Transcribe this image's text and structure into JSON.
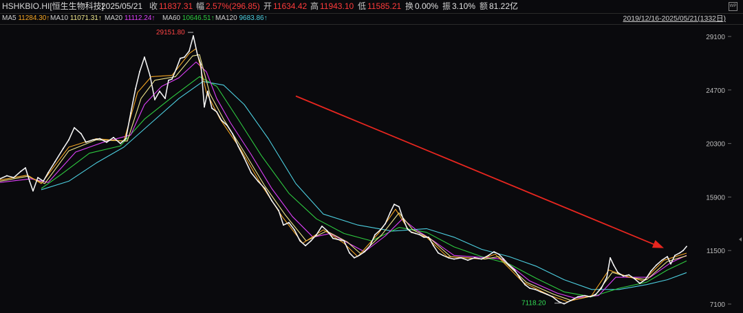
{
  "header": {
    "symbol": "HSHKBIO.HI[恒生生物科技]",
    "date": "2025/05/21",
    "close_label": "收",
    "close_value": "11837.31",
    "change_label": "幅",
    "change_value": "2.57%(296.85)",
    "open_label": "开",
    "open_value": "11634.42",
    "high_label": "高",
    "high_value": "11943.10",
    "low_label": "低",
    "low_value": "11585.21",
    "turnover_label": "换",
    "turnover_value": "0.00%",
    "amplitude_label": "振",
    "amplitude_value": "3.10%",
    "amount_label": "额",
    "amount_value": "81.22亿",
    "wp_icon": "WP"
  },
  "ma_bar": {
    "items": [
      {
        "name": "MA5",
        "value": "11284.30↑",
        "color": "#f5a623"
      },
      {
        "name": "MA10",
        "value": "11071.31↑",
        "color": "#f0e68c"
      },
      {
        "name": "MA20",
        "value": "11112.24↑",
        "color": "#e040fb"
      },
      {
        "name": "MA60",
        "value": "10646.51↑",
        "color": "#2ecc40"
      },
      {
        "name": "MA120",
        "value": "9683.86↑",
        "color": "#4dd0e1"
      }
    ],
    "range_label": "2019/12/16-2025/05/21(1332日)"
  },
  "chart_data": {
    "type": "line",
    "title": "",
    "xlabel": "",
    "ylabel": "",
    "ylim": [
      6800,
      29900
    ],
    "y_ticks": [
      "29100",
      "24700",
      "20300",
      "15900",
      "11500",
      "7100"
    ],
    "grid": false,
    "series": [
      {
        "name": "HSHKBIO.HI",
        "color": "#f2f2f2",
        "points": [
          [
            0,
            17400
          ],
          [
            10,
            17650
          ],
          [
            20,
            17500
          ],
          [
            30,
            18000
          ],
          [
            37,
            18300
          ],
          [
            43,
            17200
          ],
          [
            48,
            16400
          ],
          [
            55,
            17500
          ],
          [
            63,
            17200
          ],
          [
            70,
            17900
          ],
          [
            80,
            18800
          ],
          [
            92,
            19900
          ],
          [
            100,
            20600
          ],
          [
            108,
            21600
          ],
          [
            118,
            21100
          ],
          [
            125,
            20400
          ],
          [
            135,
            20600
          ],
          [
            145,
            20700
          ],
          [
            155,
            20400
          ],
          [
            165,
            20800
          ],
          [
            175,
            20300
          ],
          [
            183,
            20700
          ],
          [
            190,
            22800
          ],
          [
            197,
            24800
          ],
          [
            203,
            26200
          ],
          [
            210,
            27400
          ],
          [
            218,
            25900
          ],
          [
            225,
            23900
          ],
          [
            232,
            24600
          ],
          [
            240,
            24000
          ],
          [
            245,
            25500
          ],
          [
            250,
            25600
          ],
          [
            256,
            26400
          ],
          [
            262,
            27300
          ],
          [
            268,
            27400
          ],
          [
            275,
            27900
          ],
          [
            281,
            29151.8
          ],
          [
            287,
            27600
          ],
          [
            292,
            26800
          ],
          [
            297,
            23300
          ],
          [
            302,
            24600
          ],
          [
            308,
            23200
          ],
          [
            315,
            22900
          ],
          [
            322,
            22200
          ],
          [
            330,
            21800
          ],
          [
            338,
            21100
          ],
          [
            346,
            20100
          ],
          [
            355,
            19100
          ],
          [
            365,
            17900
          ],
          [
            375,
            17200
          ],
          [
            385,
            16600
          ],
          [
            395,
            15600
          ],
          [
            405,
            14800
          ],
          [
            412,
            13600
          ],
          [
            420,
            13800
          ],
          [
            428,
            13200
          ],
          [
            436,
            12300
          ],
          [
            444,
            11900
          ],
          [
            452,
            12300
          ],
          [
            460,
            12800
          ],
          [
            468,
            13500
          ],
          [
            476,
            13100
          ],
          [
            484,
            12500
          ],
          [
            492,
            12400
          ],
          [
            500,
            12300
          ],
          [
            508,
            11300
          ],
          [
            515,
            10900
          ],
          [
            522,
            11100
          ],
          [
            530,
            11400
          ],
          [
            538,
            11900
          ],
          [
            545,
            12800
          ],
          [
            553,
            13200
          ],
          [
            560,
            13700
          ],
          [
            567,
            14600
          ],
          [
            573,
            15300
          ],
          [
            580,
            15100
          ],
          [
            586,
            14100
          ],
          [
            592,
            13300
          ],
          [
            598,
            13000
          ],
          [
            604,
            12900
          ],
          [
            610,
            12800
          ],
          [
            616,
            12600
          ],
          [
            623,
            12600
          ],
          [
            630,
            11900
          ],
          [
            637,
            11300
          ],
          [
            644,
            11100
          ],
          [
            652,
            10900
          ],
          [
            660,
            10800
          ],
          [
            670,
            10900
          ],
          [
            680,
            10700
          ],
          [
            690,
            10900
          ],
          [
            700,
            10800
          ],
          [
            710,
            11100
          ],
          [
            718,
            11400
          ],
          [
            725,
            11200
          ],
          [
            732,
            10800
          ],
          [
            740,
            10300
          ],
          [
            748,
            9900
          ],
          [
            755,
            9300
          ],
          [
            763,
            8700
          ],
          [
            770,
            8400
          ],
          [
            778,
            8300
          ],
          [
            786,
            8100
          ],
          [
            795,
            7900
          ],
          [
            803,
            7700
          ],
          [
            812,
            7300
          ],
          [
            820,
            7118.2
          ],
          [
            830,
            7400
          ],
          [
            840,
            7700
          ],
          [
            850,
            7800
          ],
          [
            858,
            7700
          ],
          [
            866,
            7900
          ],
          [
            874,
            8400
          ],
          [
            882,
            9300
          ],
          [
            887,
            10900
          ],
          [
            892,
            10300
          ],
          [
            898,
            9700
          ],
          [
            906,
            9400
          ],
          [
            914,
            9500
          ],
          [
            922,
            9200
          ],
          [
            930,
            8800
          ],
          [
            938,
            9100
          ],
          [
            946,
            9800
          ],
          [
            954,
            10300
          ],
          [
            962,
            10700
          ],
          [
            970,
            11000
          ],
          [
            975,
            10400
          ],
          [
            981,
            11100
          ],
          [
            988,
            11300
          ],
          [
            993,
            11500
          ],
          [
            998,
            11837.31
          ]
        ]
      },
      {
        "name": "MA5",
        "color": "#f5a623",
        "points": [
          [
            0,
            17300
          ],
          [
            40,
            17700
          ],
          [
            60,
            17000
          ],
          [
            100,
            20000
          ],
          [
            140,
            20700
          ],
          [
            180,
            20500
          ],
          [
            200,
            24500
          ],
          [
            220,
            25800
          ],
          [
            250,
            25900
          ],
          [
            275,
            27700
          ],
          [
            285,
            28100
          ],
          [
            300,
            24500
          ],
          [
            320,
            22300
          ],
          [
            350,
            19800
          ],
          [
            380,
            16900
          ],
          [
            410,
            14300
          ],
          [
            440,
            12100
          ],
          [
            470,
            13200
          ],
          [
            500,
            12100
          ],
          [
            520,
            11000
          ],
          [
            550,
            12900
          ],
          [
            575,
            14900
          ],
          [
            595,
            13100
          ],
          [
            620,
            12600
          ],
          [
            650,
            11000
          ],
          [
            700,
            10800
          ],
          [
            720,
            11200
          ],
          [
            760,
            8900
          ],
          [
            800,
            7800
          ],
          [
            825,
            7300
          ],
          [
            860,
            7800
          ],
          [
            885,
            9900
          ],
          [
            910,
            9400
          ],
          [
            935,
            9000
          ],
          [
            965,
            10700
          ],
          [
            998,
            11284.3
          ]
        ]
      },
      {
        "name": "MA10",
        "color": "#f0e68c",
        "points": [
          [
            0,
            17200
          ],
          [
            40,
            17600
          ],
          [
            65,
            17000
          ],
          [
            100,
            19700
          ],
          [
            140,
            20600
          ],
          [
            185,
            20500
          ],
          [
            205,
            24000
          ],
          [
            225,
            25500
          ],
          [
            255,
            25800
          ],
          [
            280,
            27500
          ],
          [
            290,
            27600
          ],
          [
            305,
            24400
          ],
          [
            325,
            22300
          ],
          [
            355,
            19600
          ],
          [
            385,
            16800
          ],
          [
            415,
            14400
          ],
          [
            445,
            12300
          ],
          [
            475,
            13100
          ],
          [
            505,
            12200
          ],
          [
            525,
            11200
          ],
          [
            555,
            12800
          ],
          [
            580,
            14600
          ],
          [
            600,
            13200
          ],
          [
            625,
            12500
          ],
          [
            655,
            11000
          ],
          [
            705,
            10800
          ],
          [
            725,
            11000
          ],
          [
            765,
            8900
          ],
          [
            805,
            7900
          ],
          [
            830,
            7400
          ],
          [
            865,
            7800
          ],
          [
            890,
            9700
          ],
          [
            915,
            9300
          ],
          [
            940,
            9100
          ],
          [
            970,
            10600
          ],
          [
            998,
            11071.31
          ]
        ]
      },
      {
        "name": "MA20",
        "color": "#e040fb",
        "points": [
          [
            0,
            17100
          ],
          [
            45,
            17400
          ],
          [
            70,
            17100
          ],
          [
            110,
            19600
          ],
          [
            150,
            20400
          ],
          [
            190,
            21000
          ],
          [
            210,
            23500
          ],
          [
            235,
            25000
          ],
          [
            260,
            25700
          ],
          [
            285,
            27000
          ],
          [
            300,
            26200
          ],
          [
            315,
            24000
          ],
          [
            335,
            22000
          ],
          [
            365,
            19400
          ],
          [
            395,
            16600
          ],
          [
            425,
            14300
          ],
          [
            455,
            12600
          ],
          [
            480,
            12900
          ],
          [
            510,
            12000
          ],
          [
            530,
            11400
          ],
          [
            560,
            12700
          ],
          [
            585,
            14100
          ],
          [
            605,
            13200
          ],
          [
            630,
            12300
          ],
          [
            660,
            11100
          ],
          [
            710,
            10900
          ],
          [
            730,
            10800
          ],
          [
            770,
            9000
          ],
          [
            810,
            8000
          ],
          [
            835,
            7600
          ],
          [
            870,
            7800
          ],
          [
            895,
            9300
          ],
          [
            920,
            9300
          ],
          [
            945,
            9300
          ],
          [
            975,
            10500
          ],
          [
            998,
            11112.24
          ]
        ]
      },
      {
        "name": "MA60",
        "color": "#2ecc40",
        "points": [
          [
            60,
            16600
          ],
          [
            90,
            17800
          ],
          [
            130,
            19500
          ],
          [
            175,
            20100
          ],
          [
            210,
            22300
          ],
          [
            250,
            24100
          ],
          [
            290,
            25800
          ],
          [
            315,
            25000
          ],
          [
            345,
            22400
          ],
          [
            380,
            19300
          ],
          [
            420,
            16200
          ],
          [
            460,
            14100
          ],
          [
            500,
            12900
          ],
          [
            540,
            12300
          ],
          [
            580,
            13400
          ],
          [
            620,
            13000
          ],
          [
            660,
            11800
          ],
          [
            700,
            11000
          ],
          [
            740,
            10400
          ],
          [
            780,
            9200
          ],
          [
            820,
            8100
          ],
          [
            860,
            7700
          ],
          [
            900,
            8400
          ],
          [
            940,
            8900
          ],
          [
            970,
            9900
          ],
          [
            998,
            10646.51
          ]
        ]
      },
      {
        "name": "MA120",
        "color": "#4dd0e1",
        "points": [
          [
            60,
            16500
          ],
          [
            100,
            17200
          ],
          [
            140,
            18700
          ],
          [
            180,
            20000
          ],
          [
            220,
            22000
          ],
          [
            260,
            24000
          ],
          [
            295,
            25400
          ],
          [
            325,
            25100
          ],
          [
            355,
            23500
          ],
          [
            390,
            20700
          ],
          [
            430,
            17000
          ],
          [
            470,
            14500
          ],
          [
            520,
            13600
          ],
          [
            570,
            13100
          ],
          [
            620,
            13300
          ],
          [
            660,
            12600
          ],
          [
            700,
            11600
          ],
          [
            740,
            11000
          ],
          [
            780,
            10200
          ],
          [
            820,
            9100
          ],
          [
            860,
            8300
          ],
          [
            900,
            8300
          ],
          [
            940,
            8700
          ],
          [
            970,
            9100
          ],
          [
            998,
            9683.86
          ]
        ]
      }
    ],
    "annotations": [
      {
        "text": "29151.80",
        "x": 281,
        "y": 29151.8,
        "color": "#ff4444"
      },
      {
        "text": "7118.20",
        "x": 820,
        "y": 7118.2,
        "color": "#33dd55"
      }
    ],
    "arrow": {
      "from": [
        430,
        24200
      ],
      "to": [
        965,
        11700
      ],
      "color": "#e8261f"
    }
  }
}
